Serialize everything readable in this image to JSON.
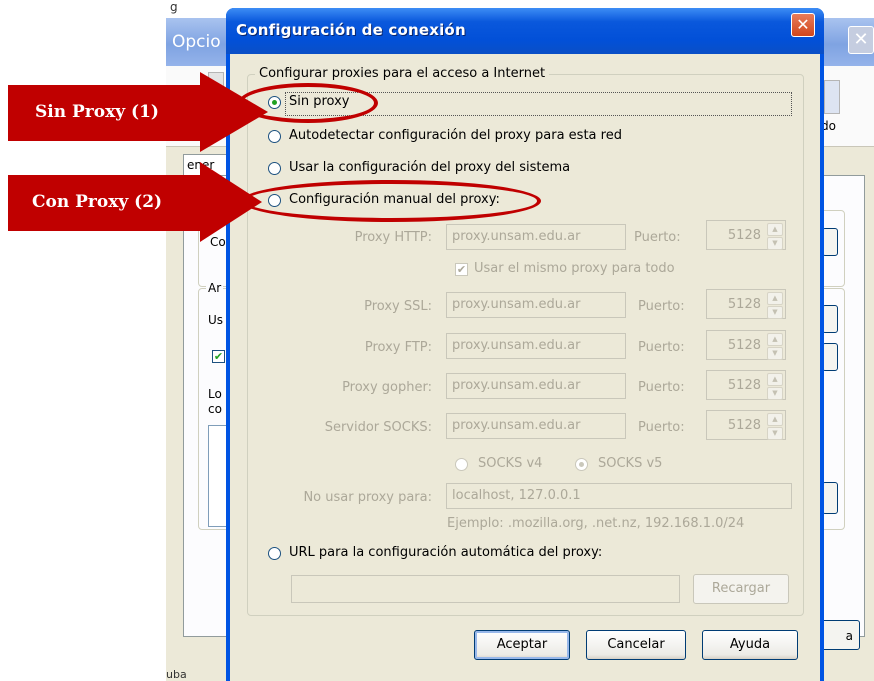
{
  "background_window": {
    "title": "Opcio",
    "title_partial_top": "g",
    "toolbar_partial": "do",
    "tab_partial": "ener",
    "group1_partial": "Co",
    "group2_legend_partial": "Ar",
    "group2_line1": "Us",
    "group2_line2": "Lo",
    "group2_line3": "co",
    "bottom_button_partial": "a",
    "status_partial": "uba"
  },
  "dialog": {
    "title": "Configuración de conexión",
    "close_symbol": "✕",
    "legend": "Configurar proxies para el acceso a Internet",
    "options": {
      "no_proxy": "Sin proxy",
      "auto_detect": "Autodetectar configuración del proxy para esta red",
      "system": "Usar la configuración del proxy del sistema",
      "manual": "Configuración manual del proxy:",
      "auto_url": "URL para la configuración automática del proxy:"
    },
    "selected_option": "no_proxy",
    "http": {
      "label": "Proxy HTTP:",
      "value": "proxy.unsam.edu.ar",
      "port_label": "Puerto:",
      "port": "5128"
    },
    "same_proxy": {
      "label": "Usar el mismo proxy para todo",
      "checked": true
    },
    "ssl": {
      "label": "Proxy SSL:",
      "value": "proxy.unsam.edu.ar",
      "port_label": "Puerto:",
      "port": "5128"
    },
    "ftp": {
      "label": "Proxy FTP:",
      "value": "proxy.unsam.edu.ar",
      "port_label": "Puerto:",
      "port": "5128"
    },
    "gopher": {
      "label": "Proxy gopher:",
      "value": "proxy.unsam.edu.ar",
      "port_label": "Puerto:",
      "port": "5128"
    },
    "socks": {
      "label": "Servidor SOCKS:",
      "value": "proxy.unsam.edu.ar",
      "port_label": "Puerto:",
      "port": "5128"
    },
    "socks_v4": "SOCKS v4",
    "socks_v5": "SOCKS v5",
    "socks_selected": "v5",
    "no_proxy_for": {
      "label": "No usar proxy para:",
      "value": "localhost, 127.0.0.1"
    },
    "example": "Ejemplo: .mozilla.org, .net.nz, 192.168.1.0/24",
    "reload_button": "Recargar",
    "buttons": {
      "accept": "Aceptar",
      "cancel": "Cancelar",
      "help": "Ayuda"
    }
  },
  "annotations": {
    "callout_1": "Sin Proxy (1)",
    "callout_2": "Con Proxy (2)",
    "accent_color": "#c00000"
  }
}
